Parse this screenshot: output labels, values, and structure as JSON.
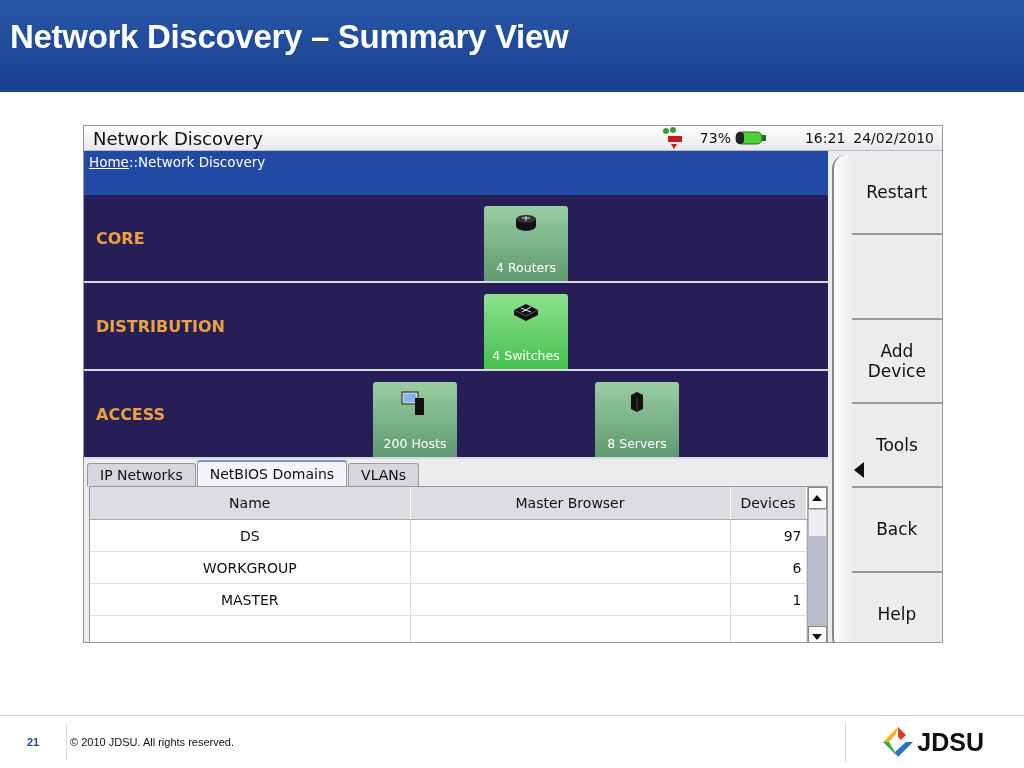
{
  "slide": {
    "title": "Network Discovery – Summary View"
  },
  "screen": {
    "title": "Network Discovery",
    "battery_percent": "73%",
    "time": "16:21",
    "date": "24/02/2010",
    "breadcrumb": {
      "link": "Home",
      "rest": "::Network Discovery"
    },
    "layers": [
      {
        "label": "CORE",
        "tiles": [
          {
            "kind": "router",
            "label": "4 Routers",
            "selected": false
          }
        ]
      },
      {
        "label": "DISTRIBUTION",
        "tiles": [
          {
            "kind": "switch",
            "label": "4 Switches",
            "selected": true
          }
        ]
      },
      {
        "label": "ACCESS",
        "tiles": [
          {
            "kind": "host",
            "label": "200 Hosts",
            "selected": false
          },
          {
            "kind": "server",
            "label": "8 Servers",
            "selected": false
          }
        ]
      }
    ],
    "tabs": [
      {
        "label": "IP Networks",
        "selected": false
      },
      {
        "label": "NetBIOS Domains",
        "selected": true
      },
      {
        "label": "VLANs",
        "selected": false
      }
    ],
    "table": {
      "columns": [
        "Name",
        "Master Browser",
        "Devices"
      ],
      "rows": [
        [
          "DS",
          "",
          "97"
        ],
        [
          "WORKGROUP",
          "",
          "6"
        ],
        [
          "MASTER",
          "",
          "1"
        ]
      ]
    },
    "softkeys": [
      {
        "label": "Restart",
        "submenu": false
      },
      {
        "submenu": false
      },
      {
        "label": "Add Device",
        "submenu": false
      },
      {
        "label": "Tools",
        "submenu": true
      },
      {
        "label": "Back",
        "submenu": false
      },
      {
        "label": "Help",
        "submenu": false
      }
    ]
  },
  "footer": {
    "page": "21",
    "copyright": "© 2010 JDSU. All rights reserved.",
    "logo_text": "JDSU"
  }
}
